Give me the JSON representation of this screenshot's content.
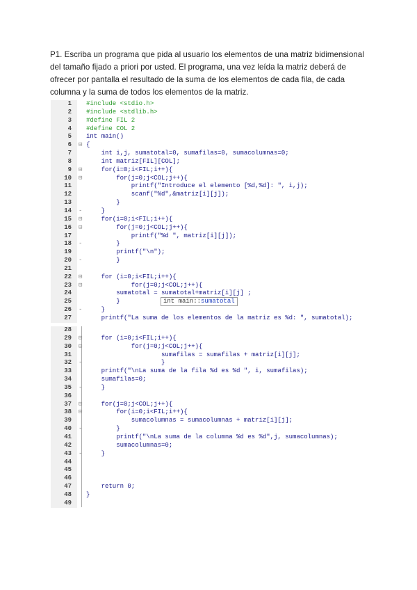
{
  "prompt": "P1. Escriba un programa que pida al usuario los elementos de una matriz bidimensional del tamaño fijado a priori por usted. El programa, una vez leída la matriz deberá de ofrecer por pantalla el resultado de la suma de los elementos de cada fila, de cada columna y la suma de todos los elementos de la matriz.",
  "tooltip": {
    "prefix": "int main::",
    "name": "sumatotal"
  },
  "block1": [
    {
      "n": "1",
      "f": "",
      "c": "#include <stdio.h>"
    },
    {
      "n": "2",
      "f": "",
      "c": "#include <stdlib.h>"
    },
    {
      "n": "3",
      "f": "",
      "c": "#define FIL 2"
    },
    {
      "n": "4",
      "f": "",
      "c": "#define COL 2"
    },
    {
      "n": "5",
      "f": "",
      "c": "int main()"
    },
    {
      "n": "6",
      "f": "⊟",
      "c": "{"
    },
    {
      "n": "7",
      "f": "",
      "c": "    int i,j, sumatotal=0, sumafilas=0, sumacolumnas=0;"
    },
    {
      "n": "8",
      "f": "",
      "c": "    int matriz[FIL][COL];"
    },
    {
      "n": "9",
      "f": "⊟",
      "c": "    for(i=0;i<FIL;i++){"
    },
    {
      "n": "10",
      "f": "⊟",
      "c": "        for(j=0;j<COL;j++){"
    },
    {
      "n": "11",
      "f": "",
      "c": "            printf(\"Introduce el elemento [%d,%d]: \", i,j);"
    },
    {
      "n": "12",
      "f": "",
      "c": "            scanf(\"%d\",&matriz[i][j]);"
    },
    {
      "n": "13",
      "f": "",
      "c": "        }"
    },
    {
      "n": "14",
      "f": "-",
      "c": "    }"
    },
    {
      "n": "15",
      "f": "⊟",
      "c": "    for(i=0;i<FIL;i++){"
    },
    {
      "n": "16",
      "f": "⊟",
      "c": "        for(j=0;j<COL;j++){"
    },
    {
      "n": "17",
      "f": "",
      "c": "            printf(\"%d \", matriz[i][j]);"
    },
    {
      "n": "18",
      "f": "-",
      "c": "        }"
    },
    {
      "n": "19",
      "f": "",
      "c": "        printf(\"\\n\");"
    },
    {
      "n": "20",
      "f": "-",
      "c": "        }"
    },
    {
      "n": "21",
      "f": "",
      "c": ""
    },
    {
      "n": "22",
      "f": "⊟",
      "c": "    for (i=0;i<FIL;i++){"
    },
    {
      "n": "23",
      "f": "⊟",
      "c": "            for(j=0;j<COL;j++){"
    },
    {
      "n": "24",
      "f": "",
      "c": "        sumatotal = sumatotal+matriz[i][j] ;"
    },
    {
      "n": "25",
      "f": "",
      "c": "        }"
    },
    {
      "n": "26",
      "f": "-",
      "c": "    }"
    },
    {
      "n": "27",
      "f": "",
      "c": "    printf(\"La suma de los elementos de la matriz es %d: \", sumatotal);"
    }
  ],
  "block2": [
    {
      "n": "28",
      "f": "",
      "c": ""
    },
    {
      "n": "29",
      "f": "⊟",
      "c": "    for (i=0;i<FIL;i++){"
    },
    {
      "n": "30",
      "f": "⊟",
      "c": "            for(j=0;j<COL;j++){"
    },
    {
      "n": "31",
      "f": "",
      "c": "                    sumafilas = sumafilas + matriz[i][j];"
    },
    {
      "n": "32",
      "f": "-",
      "c": "                    }"
    },
    {
      "n": "33",
      "f": "",
      "c": "    printf(\"\\nLa suma de la fila %d es %d \", i, sumafilas);"
    },
    {
      "n": "34",
      "f": "",
      "c": "    sumafilas=0;"
    },
    {
      "n": "35",
      "f": "-",
      "c": "    }"
    },
    {
      "n": "36",
      "f": "",
      "c": ""
    },
    {
      "n": "37",
      "f": "⊟",
      "c": "    for(j=0;j<COL;j++){"
    },
    {
      "n": "38",
      "f": "⊟",
      "c": "        for(i=0;i<FIL;i++){"
    },
    {
      "n": "39",
      "f": "",
      "c": "            sumacolumnas = sumacolumnas + matriz[i][j];"
    },
    {
      "n": "40",
      "f": "-",
      "c": "        }"
    },
    {
      "n": "41",
      "f": "",
      "c": "        printf(\"\\nLa suma de la columna %d es %d\",j, sumacolumnas);"
    },
    {
      "n": "42",
      "f": "",
      "c": "        sumacolumnas=0;"
    },
    {
      "n": "43",
      "f": "-",
      "c": "    }"
    },
    {
      "n": "44",
      "f": "",
      "c": ""
    },
    {
      "n": "45",
      "f": "",
      "c": ""
    },
    {
      "n": "46",
      "f": "",
      "c": ""
    },
    {
      "n": "47",
      "f": "",
      "c": "    return 0;"
    },
    {
      "n": "48",
      "f": "",
      "c": "}"
    },
    {
      "n": "49",
      "f": "",
      "c": ""
    }
  ]
}
